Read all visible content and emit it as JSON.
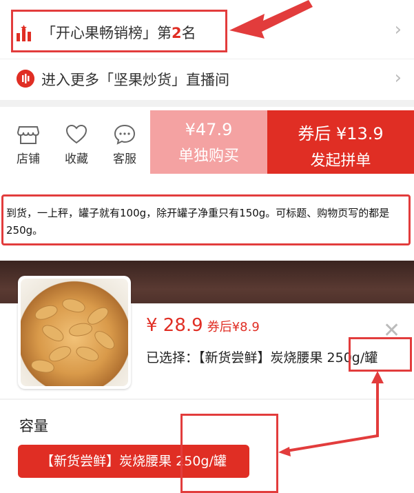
{
  "rank": {
    "prefix": "「开心果畅销榜」第",
    "number": "2",
    "suffix": "名"
  },
  "live": {
    "text": "进入更多「坚果炒货」直播间"
  },
  "bottom_bar": {
    "items": [
      {
        "label": "店铺",
        "icon": "shop-icon"
      },
      {
        "label": "收藏",
        "icon": "heart-icon"
      },
      {
        "label": "客服",
        "icon": "chat-icon"
      }
    ],
    "single_price": "¥47.9",
    "single_label": "单独购买",
    "group_price": "券后 ¥13.9",
    "group_label": "发起拼单"
  },
  "review": {
    "text": "到货，一上秤，罐子就有100g，除开罐子净重只有150g。可标题、购物页写的都是250g。"
  },
  "sku": {
    "price": "¥ 28.9",
    "after_coupon": "券后¥8.9",
    "selected_text": "已选择：【新货尝鲜】炭烧腰果 250g/罐",
    "capacity_label": "容量",
    "option_label": "【新货尝鲜】炭烧腰果 250g/罐"
  },
  "colors": {
    "accent": "#e02e24",
    "accent_light": "#f4a2a2",
    "annotation": "#e23c3c"
  }
}
